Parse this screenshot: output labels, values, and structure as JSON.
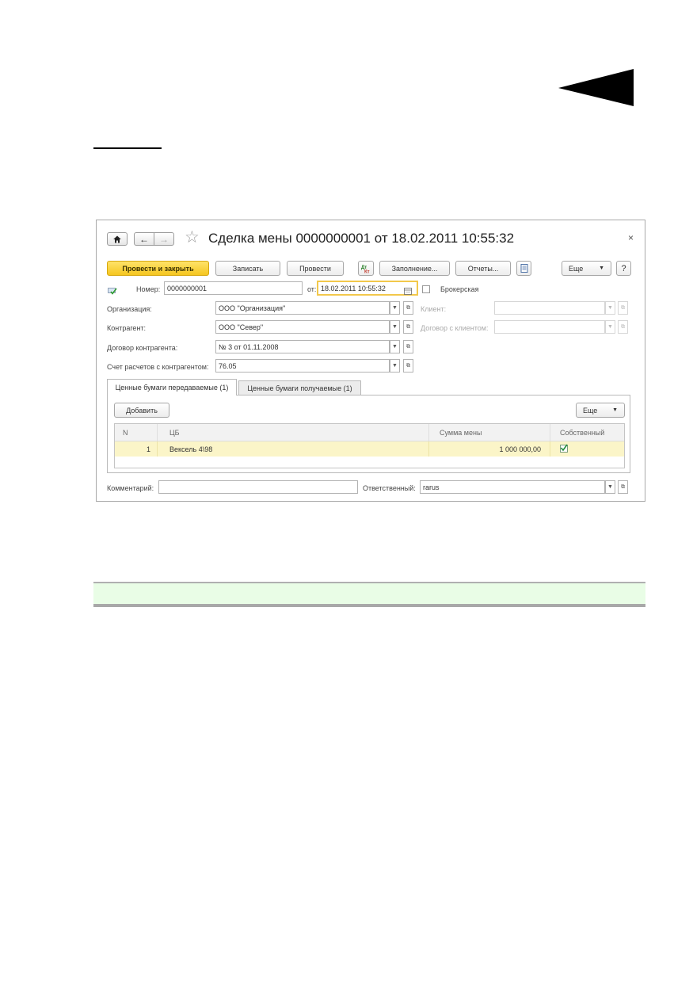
{
  "window": {
    "title": "Сделка мены 0000000001 от 18.02.2011 10:55:32",
    "close_label": "×"
  },
  "toolbar": {
    "post_close": "Провести и закрыть",
    "save": "Записать",
    "post": "Провести",
    "fill": "Заполнение...",
    "reports": "Отчеты...",
    "more": "Еще",
    "help": "?"
  },
  "header": {
    "number_label": "Номер:",
    "number_value": "0000000001",
    "date_label": "от:",
    "date_value": "18.02.2011 10:55:32",
    "brokerage_label": "Брокерская"
  },
  "fields": {
    "organization_label": "Организация:",
    "organization_value": "ООО \"Организация\"",
    "client_label": "Клиент:",
    "counterparty_label": "Контрагент:",
    "counterparty_value": "ООО \"Север\"",
    "client_contract_label": "Договор с клиентом:",
    "contract_label": "Договор контрагента:",
    "contract_value": "№ 3 от 01.11.2008",
    "account_label": "Счет расчетов с контрагентом:",
    "account_value": "76.05"
  },
  "tabs": [
    {
      "label": "Ценные бумаги передаваемые (1)",
      "active": true
    },
    {
      "label": "Ценные бумаги получаемые (1)",
      "active": false
    }
  ],
  "table_toolbar": {
    "add": "Добавить",
    "more": "Еще"
  },
  "table": {
    "columns": [
      "N",
      "ЦБ",
      "Сумма мены",
      "Собственный"
    ],
    "rows": [
      {
        "n": "1",
        "security": "Вексель 4\\98",
        "amount": "1 000 000,00",
        "own": true
      }
    ]
  },
  "footer": {
    "comment_label": "Комментарий:",
    "comment_value": "",
    "responsible_label": "Ответственный:",
    "responsible_value": "rarus"
  },
  "colors": {
    "primary_button": "#f5c61f",
    "selected_row": "#fbf5c8",
    "focus_border": "#f2c84b",
    "green_band": "#e9fde6"
  }
}
